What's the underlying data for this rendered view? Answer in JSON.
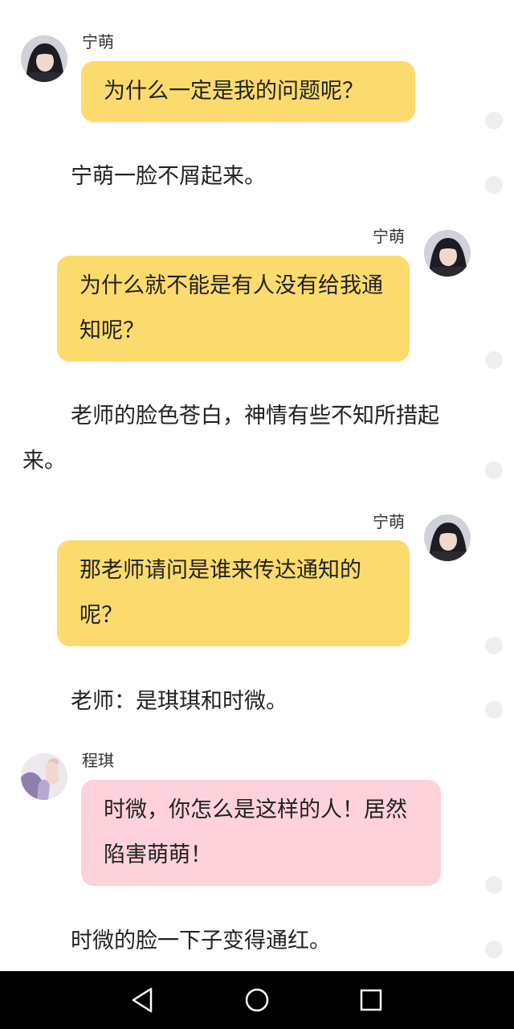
{
  "messages": [
    {
      "speaker": "宁萌",
      "text": "为什么一定是我的问题呢？"
    },
    {
      "narration": "宁萌一脸不屑起来。"
    },
    {
      "speaker": "宁萌",
      "text": "为什么就不能是有人没有给我通知呢？"
    },
    {
      "narration": "老师的脸色苍白，神情有些不知所措起来。"
    },
    {
      "speaker": "宁萌",
      "text": "那老师请问是谁来传达通知的呢？"
    },
    {
      "narration": "老师：是琪琪和时微。"
    },
    {
      "speaker": "程琪",
      "text": "时微，你怎么是这样的人！居然陷害萌萌！"
    },
    {
      "narration": "时微的脸一下子变得通红。"
    }
  ],
  "colors": {
    "bubble_yellow": "#fcdb6e",
    "bubble_pink": "#fdd2da",
    "side_dot": "#eeeeee",
    "navbar": "#000000"
  },
  "navbar": {
    "icons": [
      "back-triangle-icon",
      "home-circle-icon",
      "recents-square-icon"
    ]
  }
}
